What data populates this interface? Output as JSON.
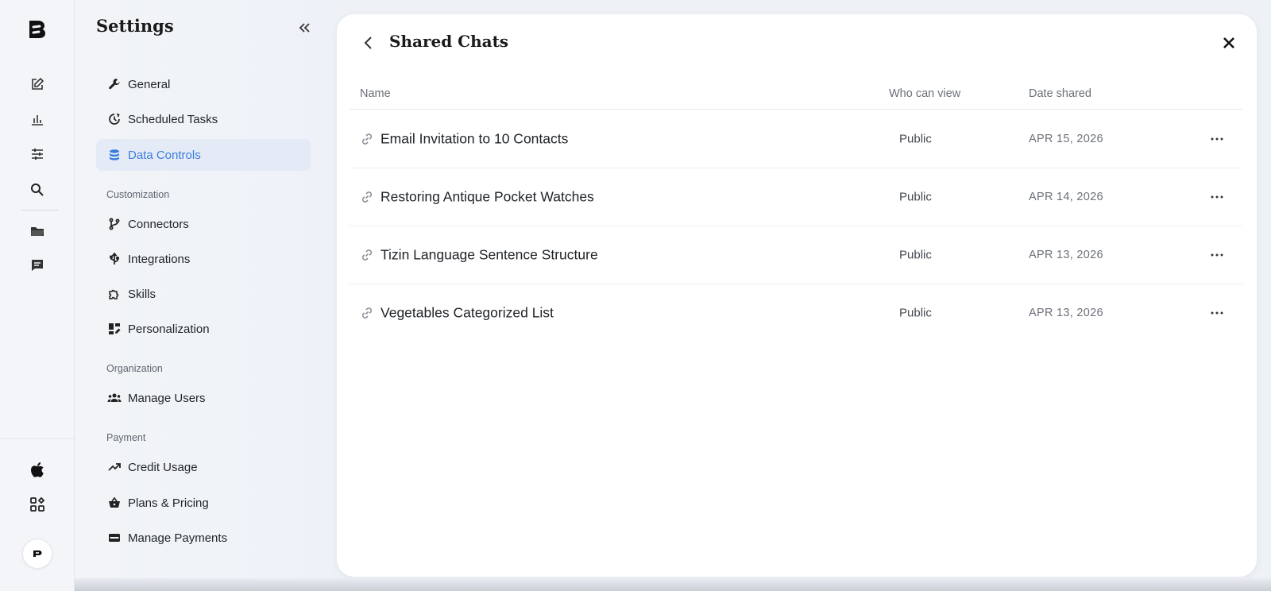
{
  "rail": {
    "icons": [
      "app-logo",
      "new-chat-icon",
      "bar-chart-icon",
      "sliders-icon",
      "search-icon",
      "folder-icon",
      "chat-bubble-icon",
      "apple-icon",
      "apps-grid-icon"
    ]
  },
  "settings": {
    "title": "Settings",
    "items_top": [
      {
        "label": "General",
        "icon": "wrench-icon"
      },
      {
        "label": "Scheduled Tasks",
        "icon": "clock-icon"
      },
      {
        "label": "Data Controls",
        "icon": "database-icon",
        "active": true
      }
    ],
    "sections": [
      {
        "label": "Customization",
        "items": [
          {
            "label": "Connectors",
            "icon": "branch-icon"
          },
          {
            "label": "Integrations",
            "icon": "usb-icon"
          },
          {
            "label": "Skills",
            "icon": "puzzle-icon"
          },
          {
            "label": "Personalization",
            "icon": "dashboard-edit-icon"
          }
        ]
      },
      {
        "label": "Organization",
        "items": [
          {
            "label": "Manage Users",
            "icon": "users-icon"
          }
        ]
      },
      {
        "label": "Payment",
        "items": [
          {
            "label": "Credit Usage",
            "icon": "trending-up-icon"
          },
          {
            "label": "Plans & Pricing",
            "icon": "basket-icon"
          },
          {
            "label": "Manage Payments",
            "icon": "credit-card-icon"
          }
        ]
      }
    ]
  },
  "panel": {
    "title": "Shared Chats",
    "columns": [
      "Name",
      "Who can view",
      "Date shared"
    ],
    "rows": [
      {
        "name": "Email Invitation to 10 Contacts",
        "who": "Public",
        "date": "APR 15, 2026"
      },
      {
        "name": "Restoring Antique Pocket Watches",
        "who": "Public",
        "date": "APR 14, 2026"
      },
      {
        "name": "Tizin Language Sentence Structure",
        "who": "Public",
        "date": "APR 13, 2026"
      },
      {
        "name": "Vegetables Categorized List",
        "who": "Public",
        "date": "APR 13, 2026"
      }
    ]
  },
  "colors": {
    "accent": "#3b7ddd",
    "active_bg": "#e4ebf6"
  }
}
